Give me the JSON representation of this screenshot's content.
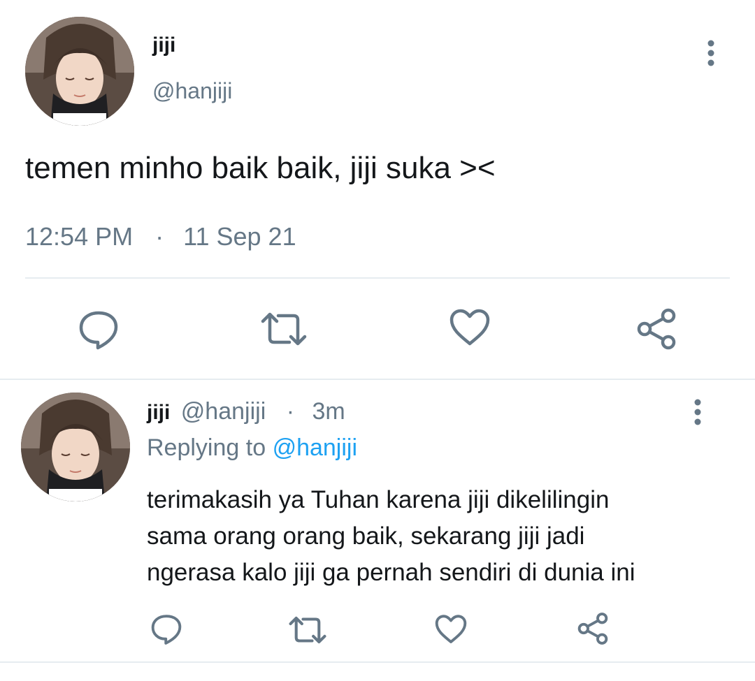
{
  "main_tweet": {
    "display_name": "jiji",
    "handle": "@hanjiji",
    "text": "temen minho baik baik, jiji suka ><",
    "time": "12:54 PM",
    "dot": "·",
    "date": "11 Sep 21"
  },
  "reply_tweet": {
    "display_name": "jiji",
    "handle": "@hanjiji",
    "dot": "·",
    "age": "3m",
    "replying_prefix": "Replying to",
    "replying_handle": "@hanjiji",
    "text_lines": [
      "terimakasih ya Tuhan karena jiji dikelilingin",
      "sama orang orang baik, sekarang jiji jadi",
      "ngerasa kalo jiji ga pernah sendiri di dunia ini"
    ]
  },
  "icons": {
    "more": "more-vertical-icon",
    "reply": "reply-icon",
    "retweet": "retweet-icon",
    "like": "heart-icon",
    "share": "share-icon"
  },
  "colors": {
    "text": "#14171a",
    "secondary": "#657786",
    "link": "#1da1f2",
    "divider": "#e6ecf0"
  }
}
